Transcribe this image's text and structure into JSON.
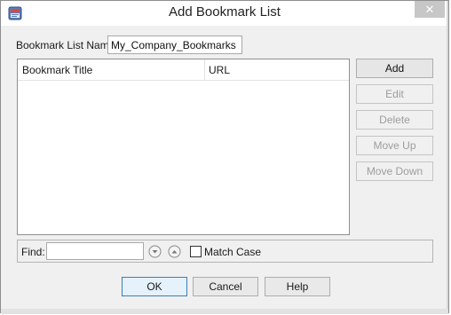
{
  "window": {
    "title": "Add Bookmark List",
    "close_label": "✕"
  },
  "form": {
    "name_label": "Bookmark List Name:",
    "name_value": "My_Company_Bookmarks"
  },
  "table": {
    "columns": [
      "Bookmark Title",
      "URL"
    ]
  },
  "side_buttons": {
    "add": "Add",
    "edit": "Edit",
    "delete": "Delete",
    "move_up": "Move Up",
    "move_down": "Move Down"
  },
  "find": {
    "label": "Find:",
    "value": "",
    "match_case_label": "Match Case"
  },
  "footer": {
    "ok": "OK",
    "cancel": "Cancel",
    "help": "Help"
  },
  "icons": {
    "app": "bookmark-list-app-icon",
    "find_next": "circle-down-arrow-icon",
    "find_prev": "circle-up-arrow-icon"
  },
  "colors": {
    "dialog_bg": "#f0f0f0",
    "default_button_border": "#3c7fb1",
    "disabled_text": "#9d9d9d"
  }
}
